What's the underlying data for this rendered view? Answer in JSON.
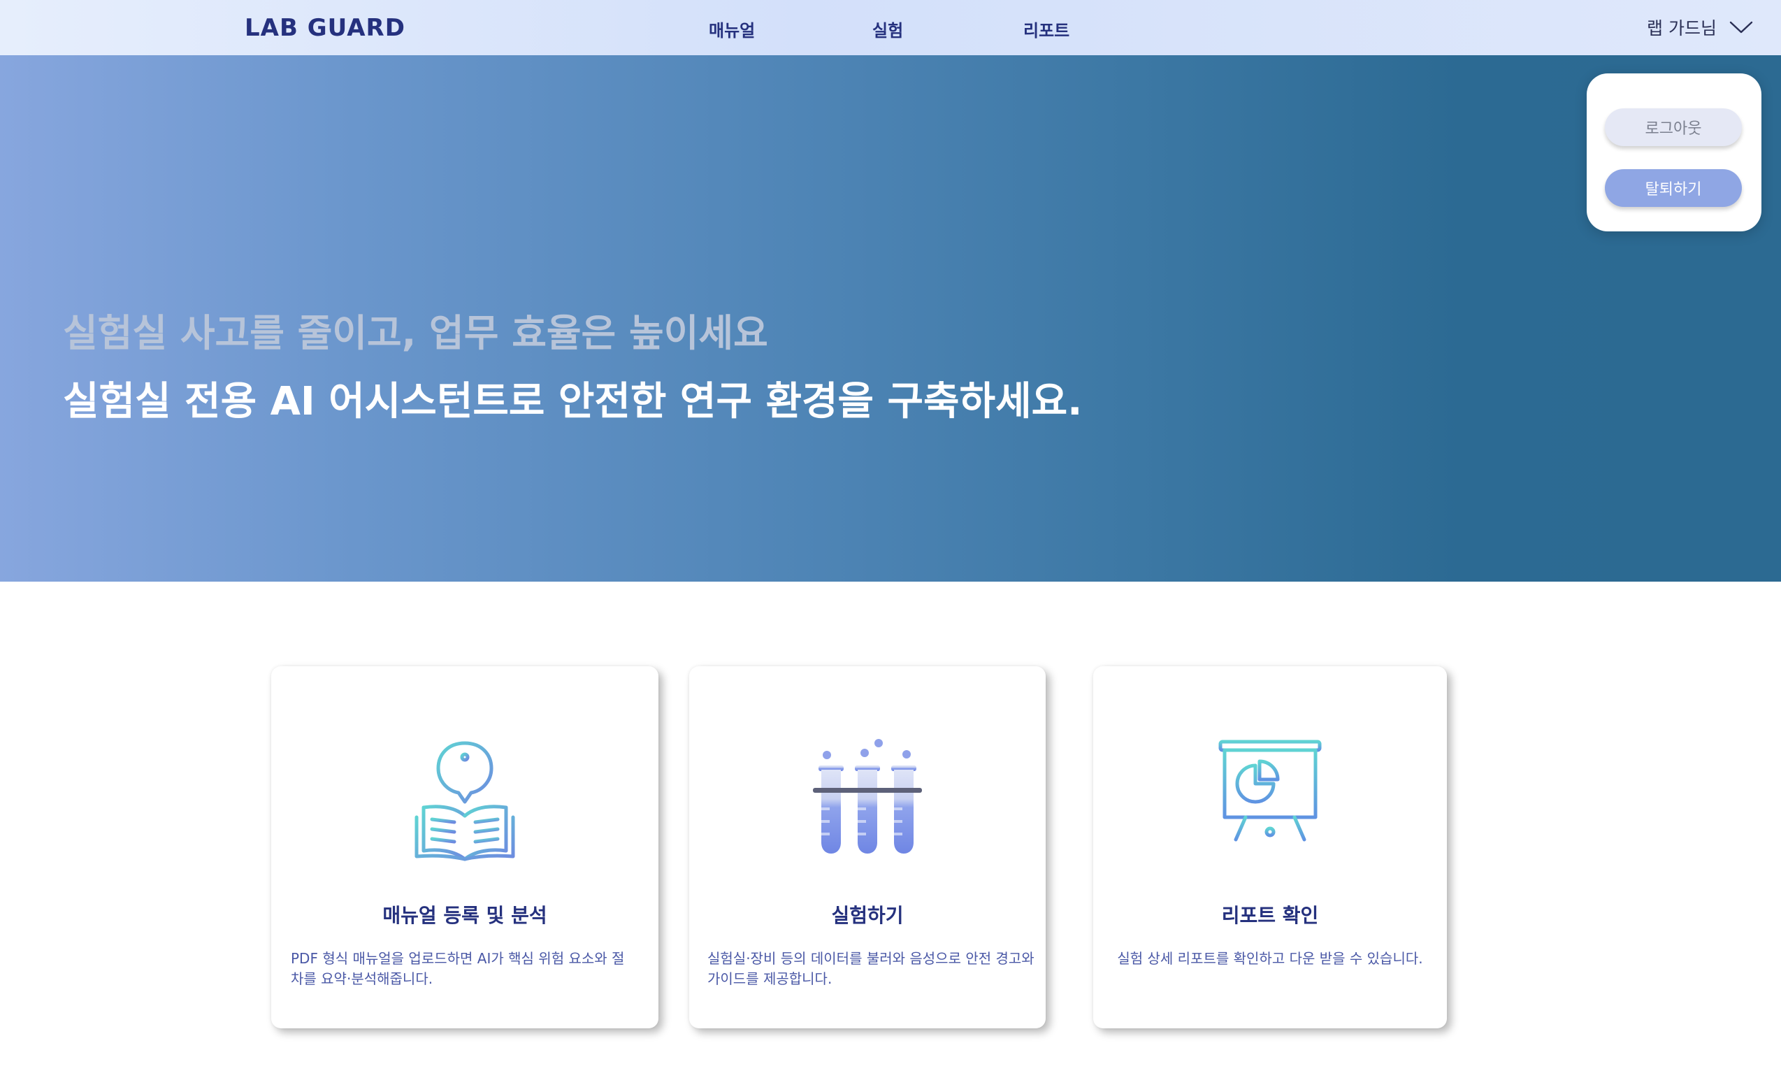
{
  "header": {
    "logo": "LAB GUARD",
    "nav": [
      {
        "label": "매뉴얼"
      },
      {
        "label": "실험"
      },
      {
        "label": "리포트"
      }
    ],
    "user": {
      "name": "랩 가드님",
      "icon": "chevron-down-icon"
    }
  },
  "user_dropdown": {
    "logout_label": "로그아웃",
    "withdraw_label": "탈퇴하기"
  },
  "hero": {
    "subtitle": "실험실 사고를 줄이고, 업무 효율은 높이세요",
    "title": "실험실 전용 AI 어시스턴트로 안전한 연구 환경을 구축하세요."
  },
  "cards": [
    {
      "icon": "manual-book-icon",
      "title": "매뉴얼 등록 및 분석",
      "desc_line1": "PDF 형식 매뉴얼을 업로드하면 AI가 핵심 위험 요소와 절",
      "desc_line2": "차를 요약·분석해줍니다."
    },
    {
      "icon": "test-tubes-icon",
      "title": "실험하기",
      "desc_line1": "실험실·장비 등의 데이터를 불러와 음성으로 안전 경고와",
      "desc_line2": "가이드를 제공합니다."
    },
    {
      "icon": "presentation-chart-icon",
      "title": "리포트 확인",
      "desc_line1": "실험 상세 리포트를 확인하고 다운 받을 수 있습니다."
    }
  ],
  "colors": {
    "brand_navy": "#25317e",
    "hero_start": "#87a6de",
    "hero_end": "#2c6a92",
    "withdraw_button": "#8fa6e4",
    "icon_gradient_start": "#5fd3d3",
    "icon_gradient_end": "#6d8ae0"
  }
}
